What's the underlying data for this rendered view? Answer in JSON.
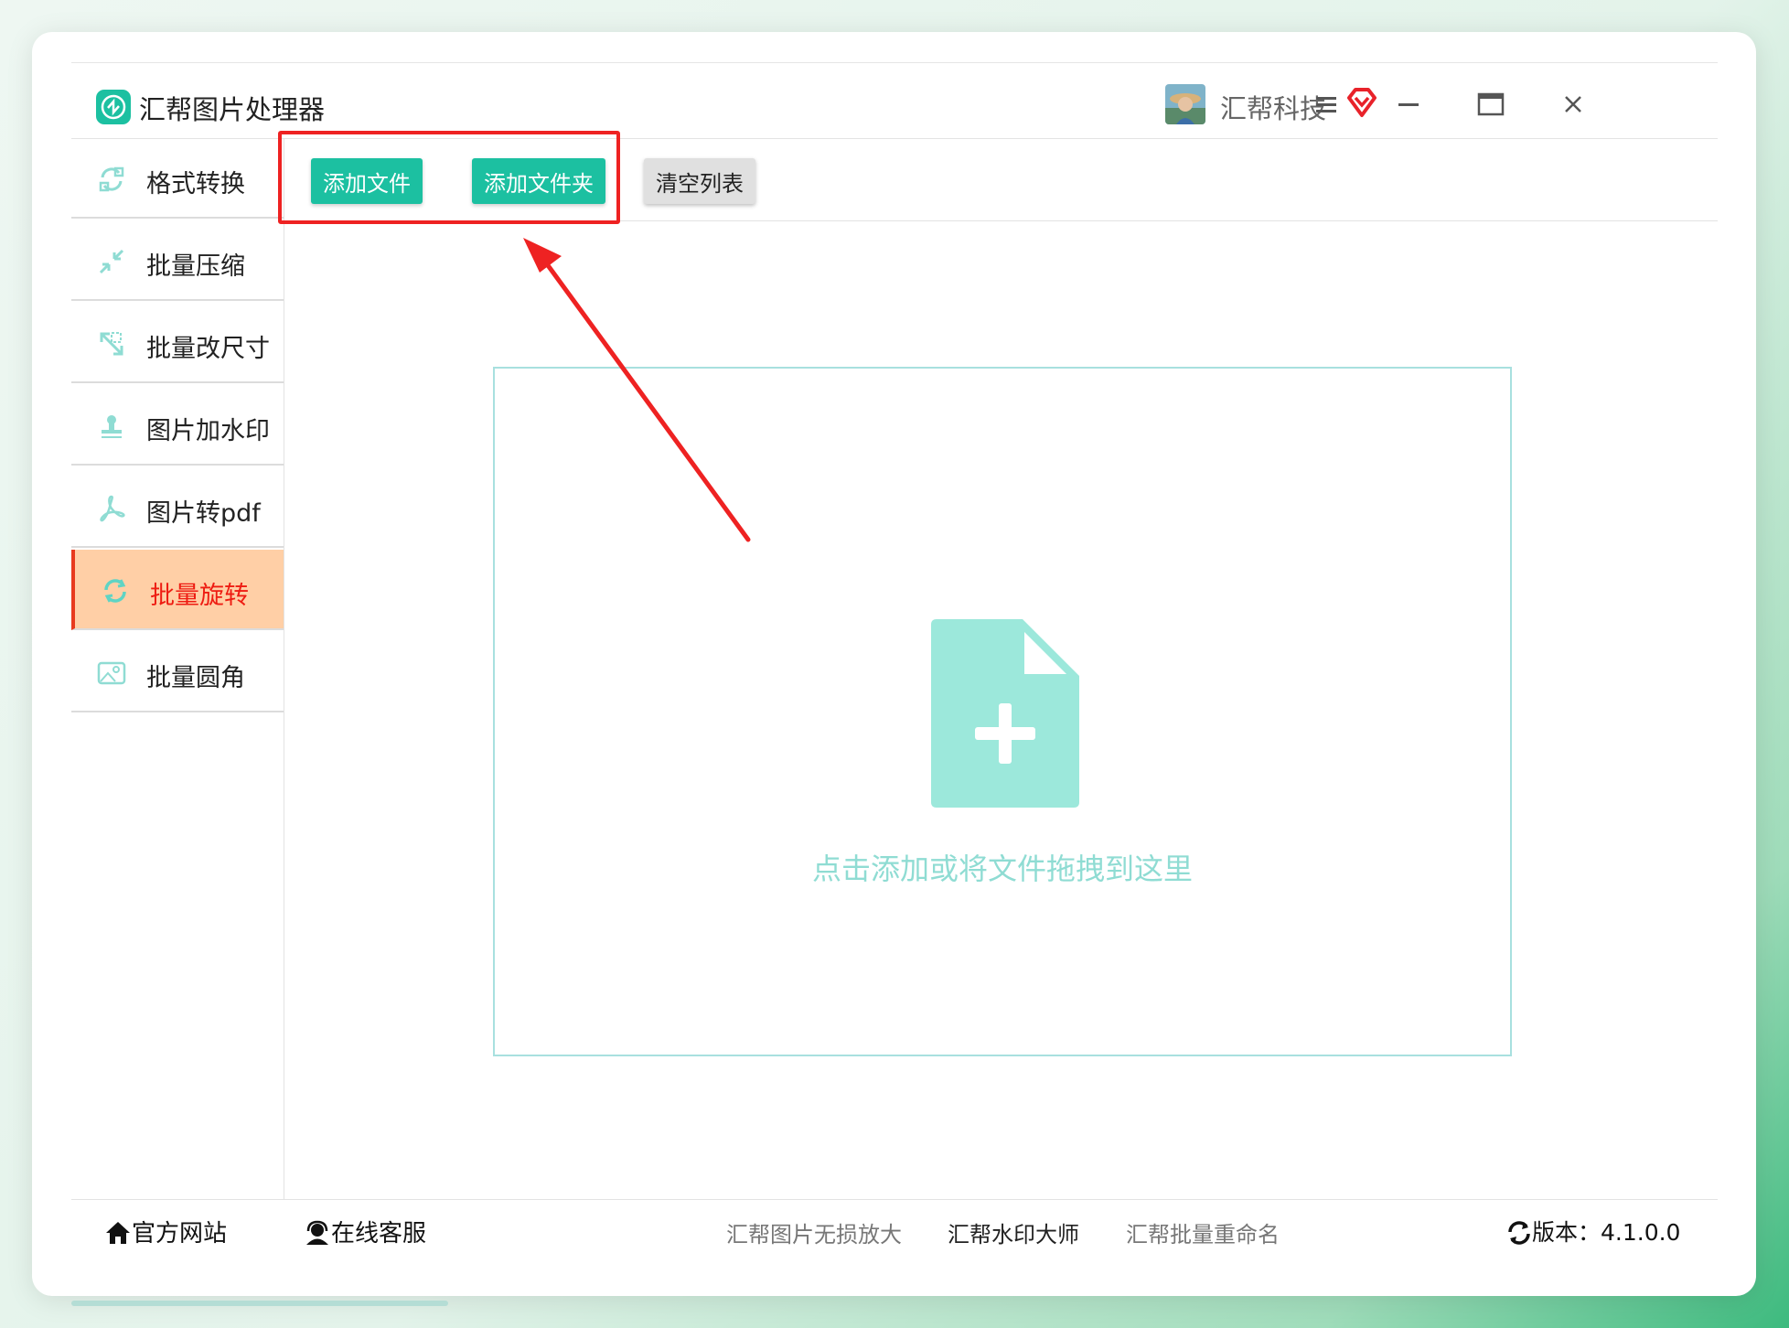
{
  "app": {
    "title": "汇帮图片处理器",
    "user_name": "汇帮科技"
  },
  "sidebar": {
    "items": [
      {
        "label": "格式转换",
        "icon": "format-convert-icon",
        "active": false
      },
      {
        "label": "批量压缩",
        "icon": "compress-icon",
        "active": false
      },
      {
        "label": "批量改尺寸",
        "icon": "resize-icon",
        "active": false
      },
      {
        "label": "图片加水印",
        "icon": "watermark-stamp-icon",
        "active": false
      },
      {
        "label": "图片转pdf",
        "icon": "pdf-icon",
        "active": false
      },
      {
        "label": "批量旋转",
        "icon": "rotate-icon",
        "active": true
      },
      {
        "label": "批量圆角",
        "icon": "image-round-corner-icon",
        "active": false
      }
    ]
  },
  "toolbar": {
    "add_file_label": "添加文件",
    "add_folder_label": "添加文件夹",
    "clear_list_label": "清空列表"
  },
  "dropzone": {
    "hint": "点击添加或将文件拖拽到这里"
  },
  "footer": {
    "website": "官方网站",
    "support": "在线客服",
    "link1": "汇帮图片无损放大",
    "link2": "汇帮水印大师",
    "link3": "汇帮批量重命名",
    "version": "版本：4.1.0.0"
  },
  "colors": {
    "accent": "#1cc0a1",
    "active_bg": "#ffcfa6",
    "active_text": "#ee1c12",
    "highlight": "#ee2222",
    "dropzone_icon": "#9ce8db"
  }
}
